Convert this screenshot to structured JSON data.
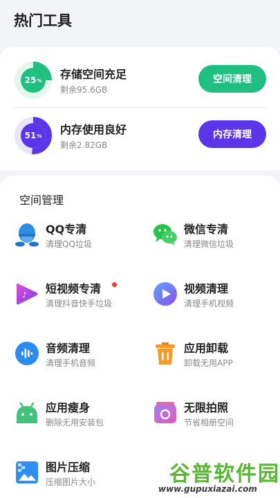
{
  "page": {
    "title": "热门工具"
  },
  "storage": {
    "percent": 25,
    "percent_sign": "%",
    "title": "存储空间充足",
    "subtitle": "剩余95.6GB",
    "button": "空间清理",
    "color": "#1fbf82"
  },
  "memory": {
    "percent": 51,
    "percent_sign": "%",
    "title": "内存使用良好",
    "subtitle": "剩余2.82GB",
    "button": "内存清理",
    "color": "#5b36e8"
  },
  "section": {
    "title": "空间管理"
  },
  "tools": [
    {
      "name": "QQ专清",
      "desc": "清理QQ垃圾",
      "icon": "qq-penguin-icon"
    },
    {
      "name": "微信专清",
      "desc": "清理微信垃圾",
      "icon": "wechat-icon"
    },
    {
      "name": "短视频专清",
      "desc": "清理抖音快手垃圾",
      "icon": "short-video-icon",
      "badge": "new-dot"
    },
    {
      "name": "视频清理",
      "desc": "清理手机视频",
      "icon": "video-play-icon"
    },
    {
      "name": "音频清理",
      "desc": "清理手机音频",
      "icon": "audio-wave-icon"
    },
    {
      "name": "应用卸载",
      "desc": "卸载无用APP",
      "icon": "trash-icon"
    },
    {
      "name": "应用瘦身",
      "desc": "删除无用安装包",
      "icon": "android-icon"
    },
    {
      "name": "无限拍照",
      "desc": "节省相册空间",
      "icon": "camera-icon"
    },
    {
      "name": "图片压缩",
      "desc": "压缩图片大小",
      "icon": "image-compress-icon"
    }
  ],
  "watermark": {
    "brand": "谷普软件园",
    "url": "www.gupuxiazai.com"
  }
}
